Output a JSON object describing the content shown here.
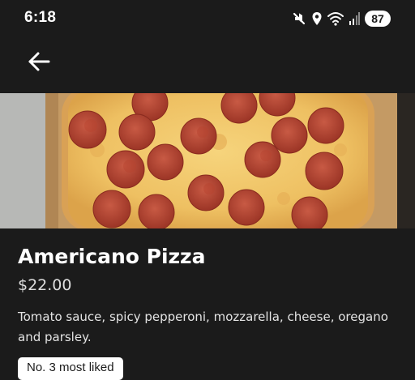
{
  "status_bar": {
    "time": "6:18",
    "battery_level": "87",
    "icons": [
      "mute-icon",
      "location-icon",
      "wifi-icon",
      "signal-icon",
      "battery-icon"
    ]
  },
  "header": {
    "back_icon": "arrow-left-icon"
  },
  "item": {
    "image": "pepperoni-pizza-photo",
    "name": "Americano Pizza",
    "price": "$22.00",
    "description": "Tomato sauce, spicy pepperoni, mozzarella, cheese, oregano and parsley.",
    "badge": "No. 3 most liked"
  },
  "colors": {
    "background": "#1b1b1b",
    "text": "#ffffff",
    "badge_background": "#ffffff"
  }
}
